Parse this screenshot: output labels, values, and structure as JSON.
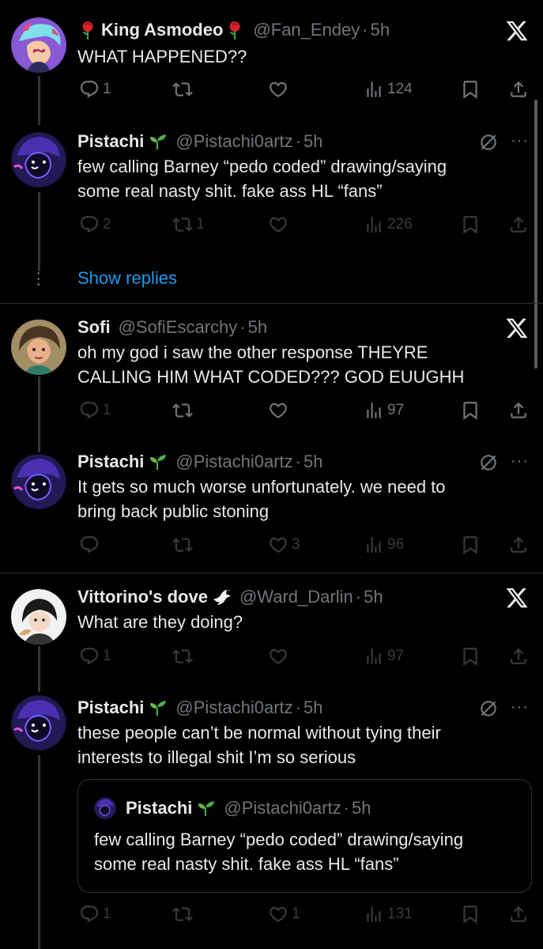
{
  "tweets": [
    {
      "name": "King Asmodeo",
      "name_prefix_emoji": "rose-icon",
      "name_suffix_emoji": "rose-icon",
      "handle": "@Fan_Endey",
      "time": "5h",
      "text": "WHAT HAPPENED??",
      "replies": "1",
      "retweets": "",
      "likes": "",
      "views": "124"
    },
    {
      "name": "Pistachi",
      "name_suffix_emoji": "seedling-icon",
      "handle": "@Pistachi0artz",
      "time": "5h",
      "text_lines": [
        "few calling Barney “pedo coded” drawing/saying",
        "some real nasty shit. fake ass HL “fans”"
      ],
      "replies": "2",
      "retweets": "1",
      "likes": "",
      "views": "226"
    },
    {
      "name": "Sofi",
      "handle": "@SofiEscarchy",
      "time": "5h",
      "text_lines": [
        "oh my god i saw the other response THEYRE",
        "CALLING HIM WHAT CODED??? GOD EUUGHH"
      ],
      "replies": "1",
      "retweets": "",
      "likes": "",
      "views": "97"
    },
    {
      "name": "Pistachi",
      "name_suffix_emoji": "seedling-icon",
      "handle": "@Pistachi0artz",
      "time": "5h",
      "text_lines": [
        "It gets so much worse unfortunately. we need to",
        "bring back public stoning"
      ],
      "replies": "",
      "retweets": "",
      "likes": "3",
      "views": "96"
    },
    {
      "name": "Vittorino's dove",
      "name_suffix_emoji": "dove-icon",
      "handle": "@Ward_Darlin",
      "time": "5h",
      "text": "What are they doing?",
      "replies": "1",
      "retweets": "",
      "likes": "",
      "views": "97"
    },
    {
      "name": "Pistachi",
      "name_suffix_emoji": "seedling-icon",
      "handle": "@Pistachi0artz",
      "time": "5h",
      "text_lines": [
        "these people can’t be normal without tying their",
        "interests to illegal shit I’m so serious"
      ],
      "quote": {
        "name": "Pistachi",
        "handle": "@Pistachi0artz",
        "time": "5h",
        "text_lines": [
          "few calling Barney “pedo coded” drawing/saying",
          "some real nasty shit. fake ass HL “fans”"
        ]
      },
      "replies": "1",
      "retweets": "",
      "likes": "1",
      "views": "131"
    }
  ],
  "show_replies_label": "Show replies",
  "time_separator": "·",
  "menu_label": "···",
  "colors": {
    "background": "#000000",
    "text": "#e7e9ea",
    "secondary": "#71767b",
    "link": "#1d9bf0",
    "divider": "#2f3336"
  }
}
